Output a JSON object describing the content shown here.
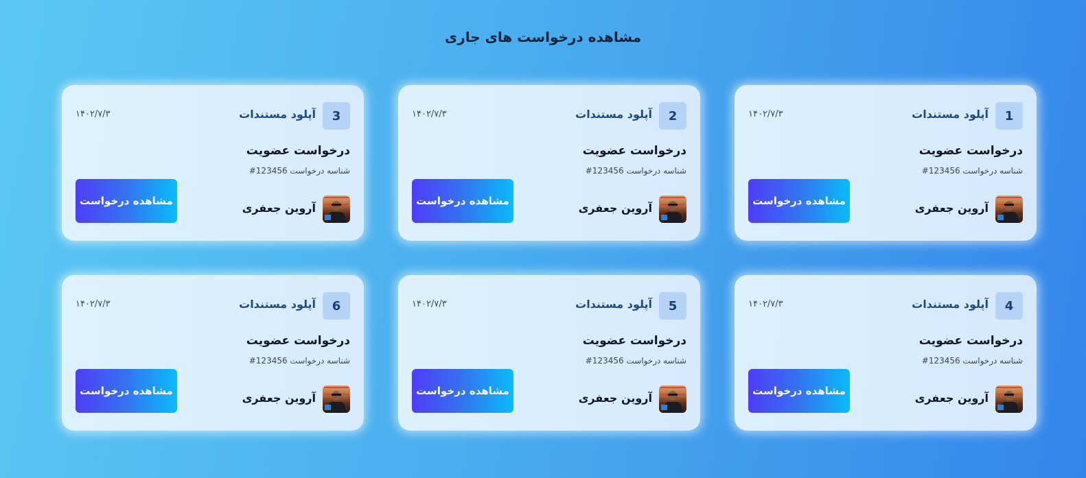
{
  "page": {
    "title": "مشاهده درخواست های جاری"
  },
  "cards": [
    {
      "number": "1",
      "type": "آپلود مستندات",
      "date": "۱۴۰۲/۷/۳",
      "title": "درخواست عضویت",
      "request_id": "شناسه درخواست 123456#",
      "user_name": "آروین جعفری",
      "button_label": "مشاهده درخواست"
    },
    {
      "number": "2",
      "type": "آپلود مستندات",
      "date": "۱۴۰۲/۷/۳",
      "title": "درخواست عضویت",
      "request_id": "شناسه درخواست 123456#",
      "user_name": "آروین جعفری",
      "button_label": "مشاهده درخواست"
    },
    {
      "number": "3",
      "type": "آپلود مستندات",
      "date": "۱۴۰۲/۷/۳",
      "title": "درخواست عضویت",
      "request_id": "شناسه درخواست 123456#",
      "user_name": "آروین جعفری",
      "button_label": "مشاهده درخواست"
    },
    {
      "number": "4",
      "type": "آپلود مستندات",
      "date": "۱۴۰۲/۷/۳",
      "title": "درخواست عضویت",
      "request_id": "شناسه درخواست 123456#",
      "user_name": "آروین جعفری",
      "button_label": "مشاهده درخواست"
    },
    {
      "number": "5",
      "type": "آپلود مستندات",
      "date": "۱۴۰۲/۷/۳",
      "title": "درخواست عضویت",
      "request_id": "شناسه درخواست 123456#",
      "user_name": "آروین جعفری",
      "button_label": "مشاهده درخواست"
    },
    {
      "number": "6",
      "type": "آپلود مستندات",
      "date": "۱۴۰۲/۷/۳",
      "title": "درخواست عضویت",
      "request_id": "شناسه درخواست 123456#",
      "user_name": "آروین جعفری",
      "button_label": "مشاهده درخواست"
    }
  ],
  "colors": {
    "background_start": "#5ac8f3",
    "background_end": "#3586ea",
    "button_start": "#4f3df6",
    "button_end": "#07bdfa",
    "badge_bg": "#b4d3f6"
  },
  "icons": {
    "avatar": "user-avatar-photo"
  }
}
